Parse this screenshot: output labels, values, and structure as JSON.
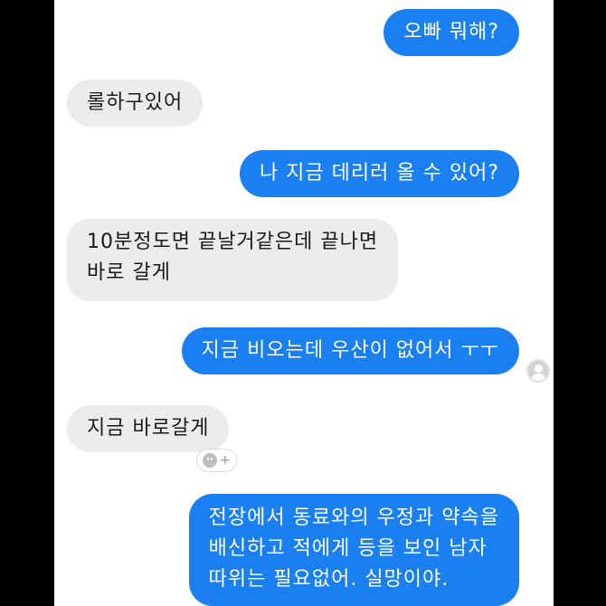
{
  "messages": [
    {
      "from": "me",
      "text": "오빠 뭐해?"
    },
    {
      "from": "them",
      "text": "롤하구있어"
    },
    {
      "from": "me",
      "text": "나 지금 데리러 올 수 있어?"
    },
    {
      "from": "them",
      "lines": [
        "10분정도면 끝날거같은데 끝나면",
        "바로 갈게"
      ]
    },
    {
      "from": "me",
      "text": "지금 비오는데 우산이 없어서 ㅜㅜ"
    },
    {
      "from": "them",
      "text": "지금 바로갈게"
    },
    {
      "from": "me",
      "lines": [
        "전장에서 동료와의 우정과 약속을",
        "배신하고 적에게 등을 보인 남자",
        "따위는 필요없어. 실망이야."
      ]
    }
  ],
  "colors": {
    "outgoing": "#1a7ff0",
    "incoming": "#ececec",
    "background": "#000000"
  }
}
